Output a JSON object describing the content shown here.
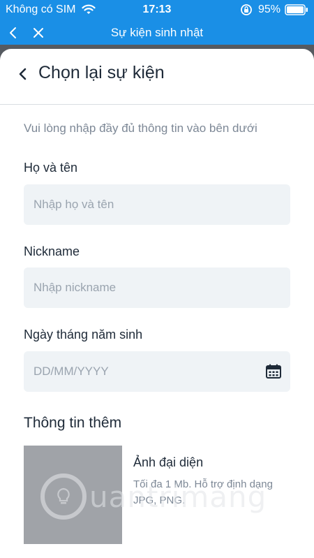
{
  "status_bar": {
    "carrier": "Không có SIM",
    "time": "17:13",
    "battery": "95%",
    "icons": [
      "wifi-icon",
      "rotation-lock-icon",
      "battery-icon"
    ]
  },
  "nav": {
    "title": "Sự kiện sinh nhật",
    "icons": [
      "back-icon",
      "close-icon"
    ]
  },
  "card": {
    "header_title": "Chọn lại sự kiện",
    "intro": "Vui lòng nhập đầy đủ thông tin vào bên dưới",
    "fields": [
      {
        "label": "Họ và tên",
        "placeholder": "Nhập họ và tên",
        "value": ""
      },
      {
        "label": "Nickname",
        "placeholder": "Nhập nickname",
        "value": ""
      },
      {
        "label": "Ngày tháng năm sinh",
        "placeholder": "DD/MM/YYYY",
        "value": "",
        "icon": "calendar-icon"
      }
    ],
    "section_title": "Thông tin thêm",
    "avatar": {
      "title": "Ảnh đại diện",
      "description": "Tối đa 1 Mb. Hỗ trợ định dạng JPG, PNG."
    }
  },
  "watermark": {
    "text": "uantrimang"
  },
  "colors": {
    "brand_blue": "#1a8fe6",
    "input_bg": "#eff3f6",
    "text_dark": "#1e2a38",
    "text_muted": "#7d8896",
    "avatar_placeholder": "#a0a3a8"
  }
}
